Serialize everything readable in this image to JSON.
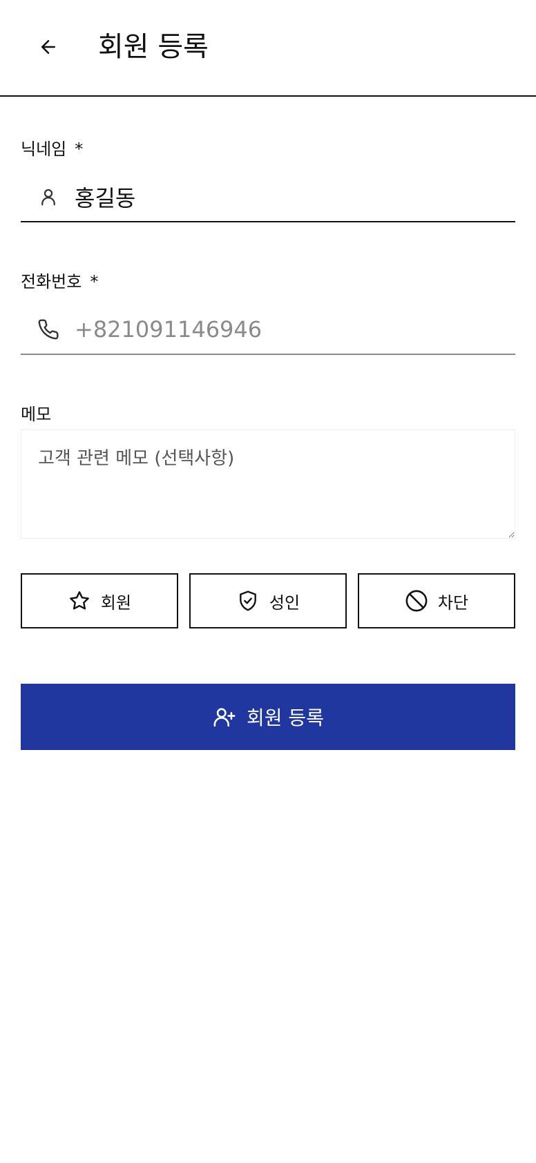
{
  "header": {
    "title": "회원 등록",
    "back_icon": "arrow-left-icon"
  },
  "form": {
    "nickname": {
      "label": "닉네임",
      "required_mark": "*",
      "icon": "user-icon",
      "value": "홍길동"
    },
    "phone": {
      "label": "전화번호",
      "required_mark": "*",
      "icon": "phone-icon",
      "placeholder": "+821091146946"
    },
    "memo": {
      "label": "메모",
      "placeholder": "고객 관련 메모 (선택사항)"
    }
  },
  "toggles": [
    {
      "label": "회원",
      "icon": "star-icon"
    },
    {
      "label": "성인",
      "icon": "shield-check-icon"
    },
    {
      "label": "차단",
      "icon": "ban-icon"
    }
  ],
  "submit": {
    "label": "회원 등록",
    "icon": "user-plus-icon"
  },
  "colors": {
    "primary": "#2137a0",
    "text": "#111111",
    "placeholder": "#8a8a8a",
    "border": "#111111"
  }
}
